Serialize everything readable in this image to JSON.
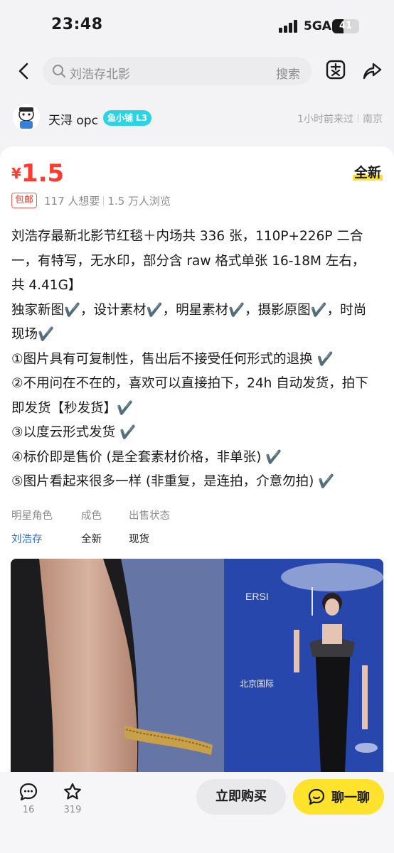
{
  "status_bar": {
    "time": "23:48",
    "network": "5GA",
    "battery": "41",
    "battery_level": 0.41
  },
  "nav": {
    "search_query": "刘浩存北影",
    "search_button": "搜索"
  },
  "seller": {
    "name": "天浔 opc",
    "badge": "鱼小铺 L3",
    "last_seen": "1小时前来过",
    "location": "南京"
  },
  "item": {
    "currency": "¥",
    "price": "1.5",
    "condition": "全新",
    "shipping_tag": "包邮",
    "wants": "117 人想要",
    "views": "1.5 万人浏览",
    "description": [
      "刘浩存最新北影节红毯＋内场共 336 张，110P+226P 二合一，有特写，无水印，部分含 raw 格式单张 16-18M 左右，共 4.41G】",
      "独家新图✔️，设计素材✔️，明星素材✔️，摄影原图✔️，时尚现场✔️",
      "①图片具有可复制性，售出后不接受任何形式的退换 ✔️",
      "②不用问在不在的，喜欢可以直接拍下，24h 自动发货，拍下即发货【秒发货】✔️",
      "③以度云形式发货 ✔️",
      "④标价即是售价 (是全套素材价格，非单张) ✔️",
      "⑤图片看起来很多一样 (非重复，是连拍，介意勿拍) ✔️"
    ],
    "attributes": [
      {
        "label": "明星角色",
        "value": "刘浩存"
      },
      {
        "label": "成色",
        "value": "全新"
      },
      {
        "label": "出售状态",
        "value": "现货"
      }
    ]
  },
  "bottom_bar": {
    "comments": "16",
    "favorites": "319",
    "buy_label": "立即购买",
    "chat_label": "聊一聊"
  },
  "colors": {
    "price": "#ff3b30",
    "accent_yellow": "#ffe22b",
    "badge_cyan": "#2ad4e4",
    "link_blue": "#2f6fd6"
  }
}
